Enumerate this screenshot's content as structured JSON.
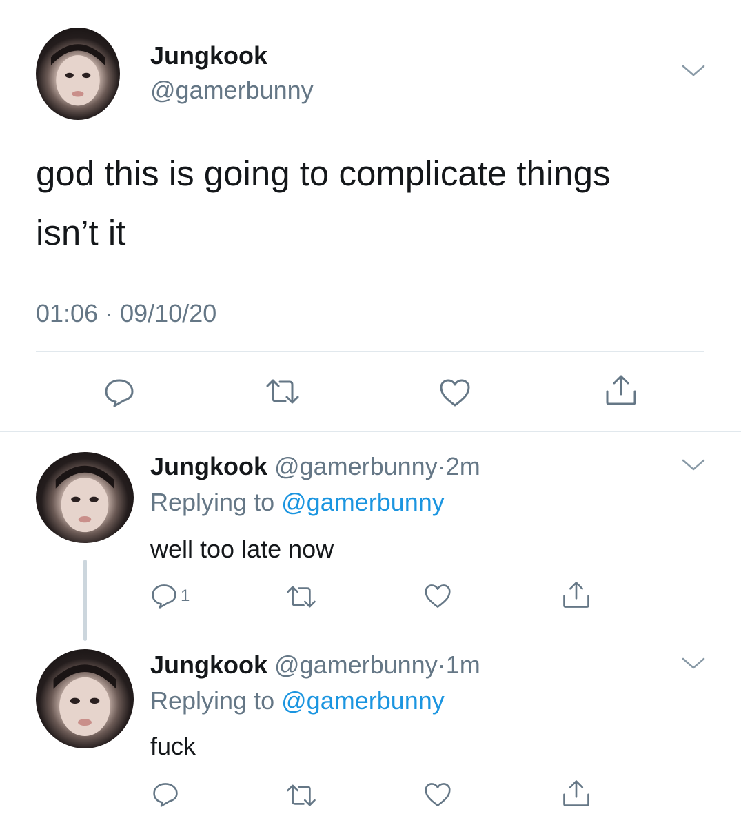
{
  "main_tweet": {
    "display_name": "Jungkook",
    "handle": "@gamerbunny",
    "text_line1": "god this is going to complicate things",
    "text_line2": "isn’t it",
    "time": "01:06",
    "separator": "·",
    "date": "09/10/20"
  },
  "replies": [
    {
      "display_name": "Jungkook",
      "handle": "@gamerbunny",
      "separator": "·",
      "age": "2m",
      "replying_prefix": "Replying to",
      "replying_handle": "@gamerbunny",
      "text": "well too late now",
      "reply_count": "1"
    },
    {
      "display_name": "Jungkook",
      "handle": "@gamerbunny",
      "separator": "·",
      "age": "1m",
      "replying_prefix": "Replying to",
      "replying_handle": "@gamerbunny",
      "text": "fuck",
      "reply_count": ""
    }
  ],
  "icons": [
    "chevron-down-icon",
    "reply-icon",
    "retweet-icon",
    "like-icon",
    "share-icon"
  ],
  "colors": {
    "text": "#14171a",
    "muted": "#657786",
    "link": "#1b95e0",
    "divider": "#e1e8ed"
  }
}
